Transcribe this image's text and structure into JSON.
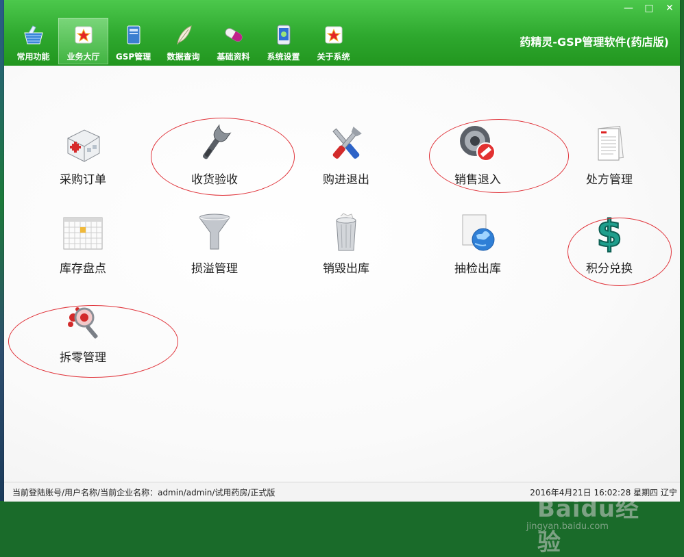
{
  "window": {
    "app_title": "药精灵-GSP管理软件(药店版)",
    "controls": {
      "minimize": "—",
      "maximize": "□",
      "close": "✕"
    }
  },
  "menu": [
    {
      "label": "常用功能",
      "icon": "basket-icon",
      "active": false
    },
    {
      "label": "业务大厅",
      "icon": "star-badge-icon",
      "active": true
    },
    {
      "label": "GSP管理",
      "icon": "book-icon",
      "active": false
    },
    {
      "label": "数据查询",
      "icon": "feather-icon",
      "active": false
    },
    {
      "label": "基础资料",
      "icon": "pill-icon",
      "active": false
    },
    {
      "label": "系统设置",
      "icon": "android-device-icon",
      "active": false
    },
    {
      "label": "关于系统",
      "icon": "star-badge-icon",
      "active": false
    }
  ],
  "tiles": [
    {
      "label": "采购订单",
      "icon": "hospital-icon",
      "circled": false
    },
    {
      "label": "收货验收",
      "icon": "wrench-icon",
      "circled": true
    },
    {
      "label": "购进退出",
      "icon": "tools-icon",
      "circled": false
    },
    {
      "label": "销售退入",
      "icon": "speaker-blocked-icon",
      "circled": true
    },
    {
      "label": "处方管理",
      "icon": "prescription-icon",
      "circled": false
    },
    {
      "label": "库存盘点",
      "icon": "calendar-icon",
      "circled": false
    },
    {
      "label": "损溢管理",
      "icon": "funnel-icon",
      "circled": false
    },
    {
      "label": "销毁出库",
      "icon": "trash-can-icon",
      "circled": false
    },
    {
      "label": "抽检出库",
      "icon": "globe-document-icon",
      "circled": false
    },
    {
      "label": "积分兑换",
      "icon": "dollar-icon",
      "circled": true
    },
    {
      "label": "拆零管理",
      "icon": "magnifier-icon",
      "circled": true
    }
  ],
  "status": {
    "left": "当前登陆账号/用户名称/当前企业名称：admin/admin/试用药房/正式版",
    "right": "2016年4月21日 16:02:28 星期四 辽宁"
  },
  "watermark": {
    "main": "Baidu经验",
    "sub": "jingyan.baidu.com"
  },
  "colors": {
    "titlebar": "#2ea82e",
    "circle": "#e0333a"
  }
}
